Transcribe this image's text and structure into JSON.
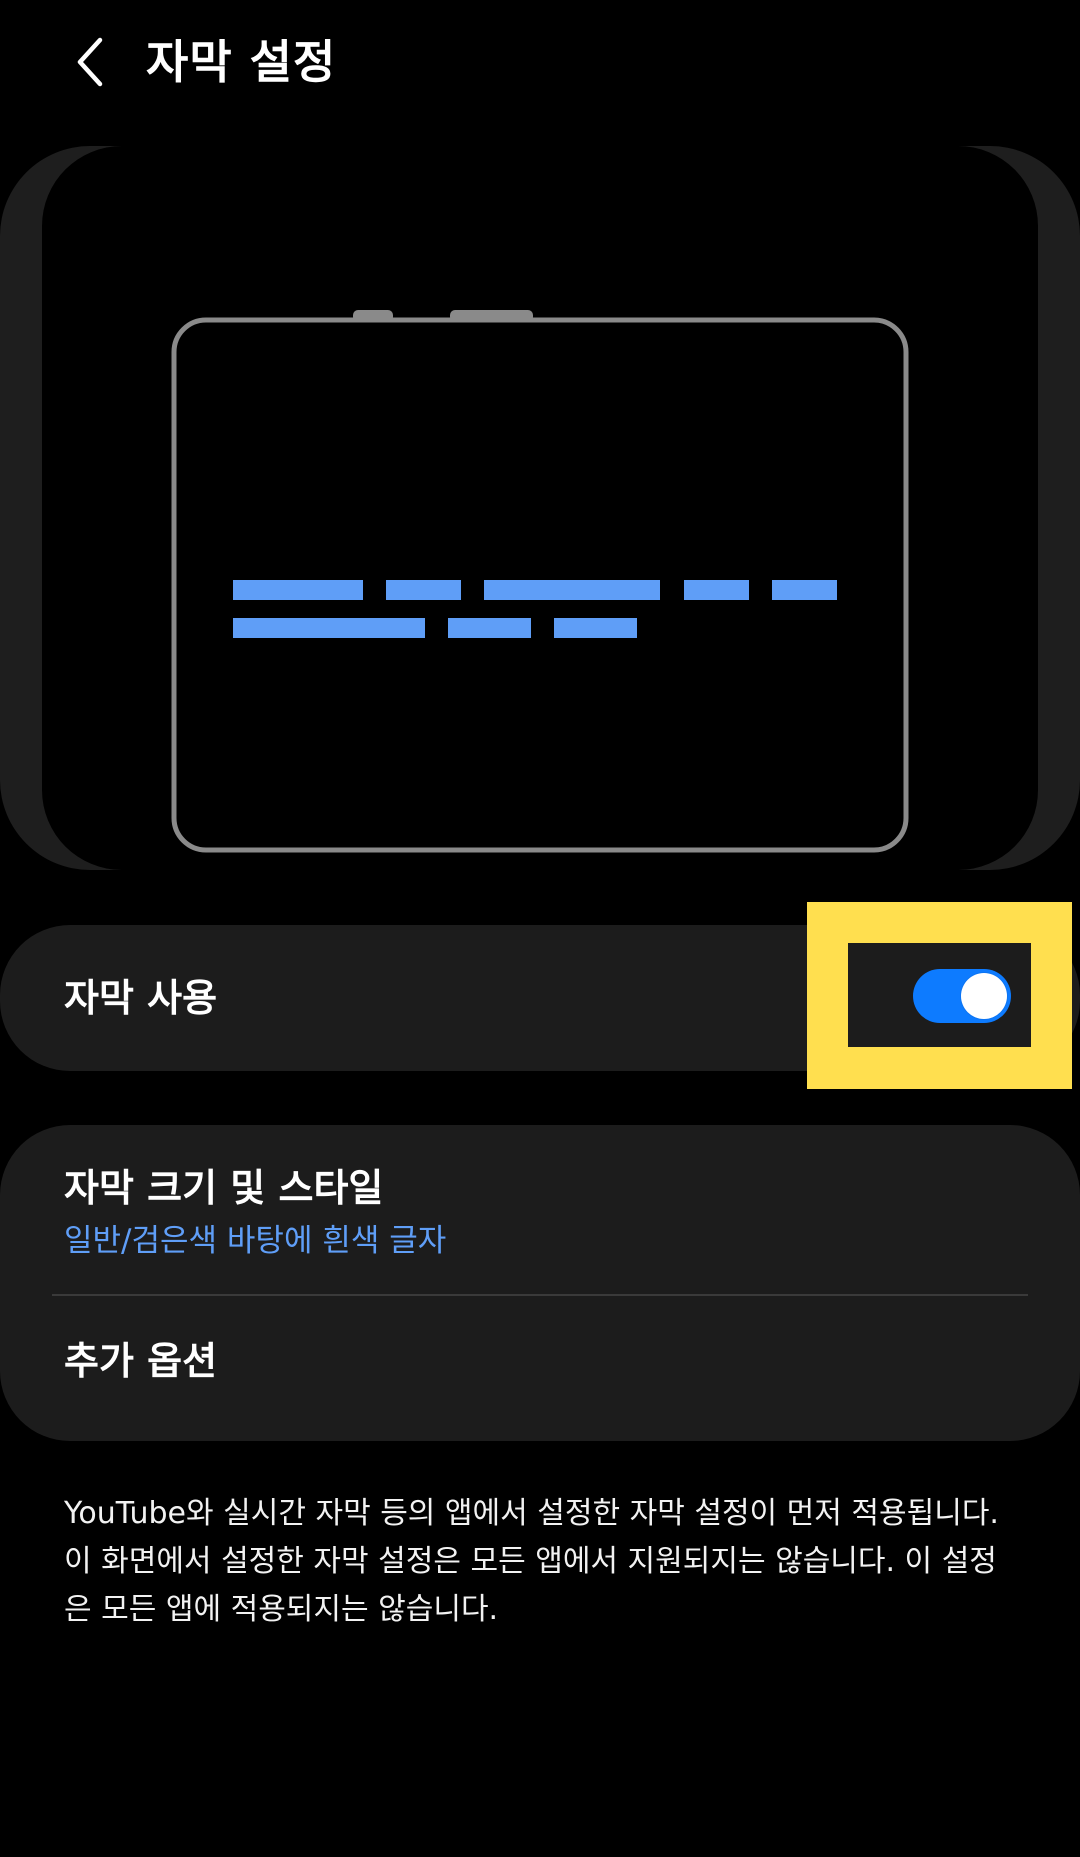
{
  "header": {
    "title": "자막 설정",
    "back_icon": "chevron-left-icon"
  },
  "preview": {
    "caption_color": "#5f9ef7",
    "phone_outline_color": "#8a8a8a"
  },
  "caption_toggle": {
    "label": "자막 사용",
    "checked": true,
    "accent_color": "#0d7bff",
    "highlight_color": "#ffdf4f"
  },
  "options": {
    "size_style": {
      "title": "자막 크기 및 스타일",
      "value": "일반/검은색 바탕에 흰색 글자"
    },
    "more_options": {
      "title": "추가 옵션"
    }
  },
  "footnote": "YouTube와 실시간 자막 등의 앱에서 설정한 자막 설정이 먼저 적용됩니다. 이 화면에서 설정한 자막 설정은 모든 앱에서 지원되지는 않습니다. 이 설정은 모든 앱에 적용되지는 않습니다."
}
